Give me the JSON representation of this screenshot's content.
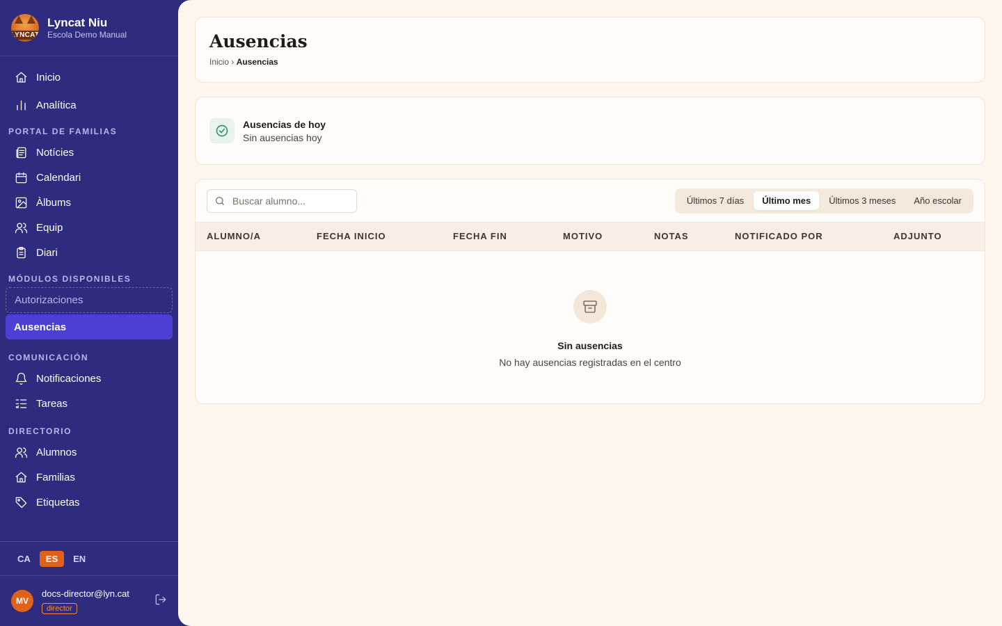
{
  "brand": {
    "title": "Lyncat Niu",
    "subtitle": "Escola Demo Manual",
    "logo_text": "LYNCAT"
  },
  "nav": {
    "top": [
      {
        "label": "Inicio",
        "icon": "home-icon"
      },
      {
        "label": "Analítica",
        "icon": "bar-chart-icon"
      }
    ],
    "sections": {
      "portal": "PORTAL DE FAMILIAS",
      "modules": "MÓDULOS DISPONIBLES",
      "comms": "COMUNICACIÓN",
      "directory": "DIRECTORIO"
    },
    "portal_items": [
      {
        "label": "Notícies",
        "icon": "newspaper-icon"
      },
      {
        "label": "Calendari",
        "icon": "calendar-icon"
      },
      {
        "label": "Àlbums",
        "icon": "image-icon"
      },
      {
        "label": "Equip",
        "icon": "users-icon"
      },
      {
        "label": "Diari",
        "icon": "clipboard-icon"
      }
    ],
    "module_items": [
      {
        "label": "Autorizaciones",
        "state": "available"
      },
      {
        "label": "Ausencias",
        "state": "active"
      }
    ],
    "comms_items": [
      {
        "label": "Notificaciones",
        "icon": "bell-icon"
      },
      {
        "label": "Tareas",
        "icon": "list-check-icon"
      }
    ],
    "directory_items": [
      {
        "label": "Alumnos",
        "icon": "users-icon"
      },
      {
        "label": "Familias",
        "icon": "home-icon"
      },
      {
        "label": "Etiquetas",
        "icon": "tag-icon"
      }
    ]
  },
  "languages": {
    "items": [
      "CA",
      "ES",
      "EN"
    ],
    "active": "ES"
  },
  "user": {
    "initials": "MV",
    "email": "docs-director@lyn.cat",
    "role": "director"
  },
  "header": {
    "title": "Ausencias",
    "breadcrumb_home": "Inicio",
    "breadcrumb_sep": "›",
    "breadcrumb_current": "Ausencias"
  },
  "today": {
    "title": "Ausencias de hoy",
    "subtitle": "Sin ausencias hoy"
  },
  "search": {
    "placeholder": "Buscar alumno...",
    "value": ""
  },
  "filters": {
    "options": [
      "Últimos 7 días",
      "Último mes",
      "Últimos 3 meses",
      "Año escolar"
    ],
    "selected": "Último mes"
  },
  "table": {
    "columns": [
      "ALUMNO/A",
      "FECHA INICIO",
      "FECHA FIN",
      "MOTIVO",
      "NOTAS",
      "NOTIFICADO POR",
      "ADJUNTO"
    ],
    "rows": []
  },
  "empty": {
    "title": "Sin ausencias",
    "subtitle": "No hay ausencias registradas en el centro"
  },
  "colors": {
    "sidebar": "#2f2b7e",
    "accent": "#4b3fd6",
    "orange": "#e0621a",
    "background": "#fff6ee"
  }
}
